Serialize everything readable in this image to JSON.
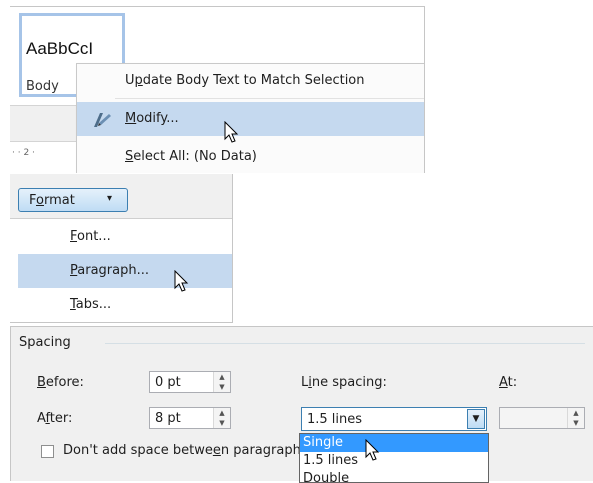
{
  "styles_gallery": {
    "sample_text": "AaBbCcI",
    "style_name": "Body"
  },
  "ruler": {
    "marks": [
      "· · 2 ·"
    ]
  },
  "context_menu": {
    "items": [
      {
        "label": "Update Body Text to Match Selection"
      },
      {
        "label": "Modify..."
      },
      {
        "label": "Select All: (No Data)"
      }
    ]
  },
  "format_menu": {
    "button_label": "Format",
    "button_arrow": "▾",
    "items": [
      {
        "label": "Font..."
      },
      {
        "label": "Paragraph..."
      },
      {
        "label": "Tabs..."
      }
    ]
  },
  "spacing": {
    "section_title": "Spacing",
    "before_label": "Before:",
    "before_value": "0 pt",
    "after_label": "After:",
    "after_value": "8 pt",
    "line_spacing_label": "Line spacing:",
    "line_spacing_value": "1.5 lines",
    "at_label": "At:",
    "at_value": "",
    "dont_add_label": "Don't add space between paragraphs",
    "line_spacing_options": [
      "Single",
      "1.5 lines",
      "Double"
    ]
  },
  "colors": {
    "highlight": "#c5d9ef",
    "selected_option": "#3399ff",
    "gallery_border": "#a6c4e8"
  }
}
